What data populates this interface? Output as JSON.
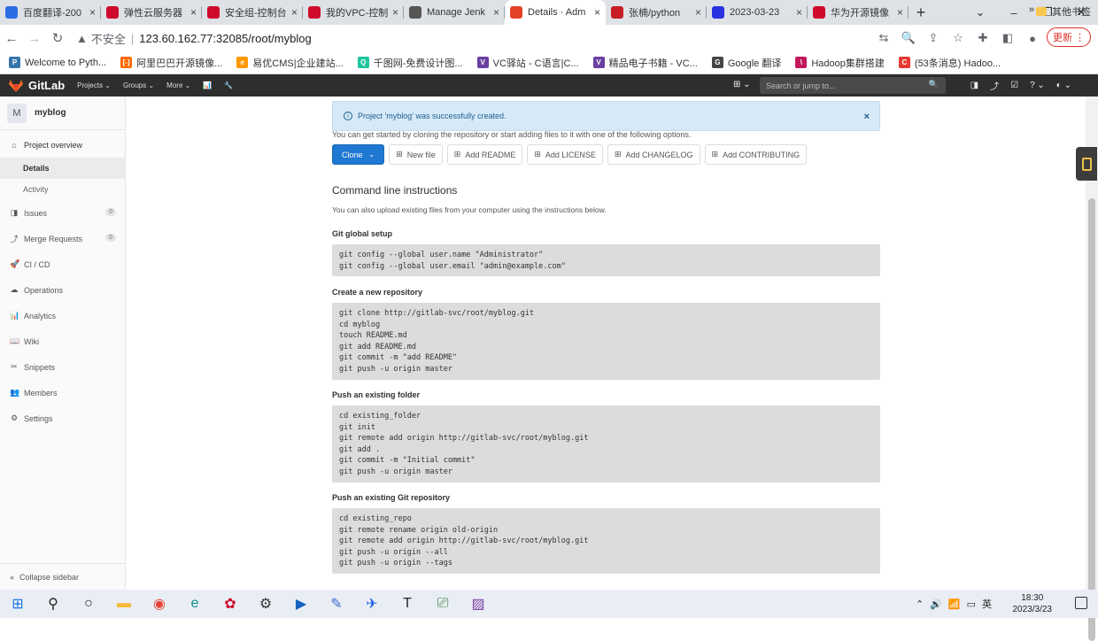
{
  "browser": {
    "tabs": [
      {
        "label": "百度翻译-200",
        "icon": "baidu-translate-icon",
        "color": "#2b6de5",
        "active": false
      },
      {
        "label": "弹性云服务器",
        "icon": "huawei-icon",
        "color": "#cf0a2c",
        "active": false
      },
      {
        "label": "安全组-控制台",
        "icon": "huawei-icon",
        "color": "#cf0a2c",
        "active": false
      },
      {
        "label": "我的VPC-控制",
        "icon": "huawei-icon",
        "color": "#cf0a2c",
        "active": false
      },
      {
        "label": "Manage Jenk",
        "icon": "jenkins-icon",
        "color": "#555555",
        "active": false
      },
      {
        "label": "Details · Adm",
        "icon": "gitlab-icon",
        "color": "#e24329",
        "active": true
      },
      {
        "label": "张楠/python",
        "icon": "gitee-icon",
        "color": "#c71d23",
        "active": false
      },
      {
        "label": "2023-03-23",
        "icon": "baidu-icon",
        "color": "#2932e1",
        "active": false
      },
      {
        "label": "华为开源镜像",
        "icon": "huawei-icon",
        "color": "#cf0a2c",
        "active": false
      }
    ],
    "tab_close": "×",
    "new_tab": "+",
    "window_controls": [
      "⌄",
      "–",
      "❐",
      "✕"
    ],
    "nav": {
      "back": "←",
      "forward": "→",
      "reload": "↻"
    },
    "address": {
      "warning": "▲",
      "insecure": "不安全",
      "sep": "|",
      "url": "123.60.162.77:32085/root/myblog"
    },
    "toolbar_icons": [
      "translate-icon",
      "zoom-icon",
      "share-icon",
      "star-icon",
      "extensions-icon",
      "sidepanel-icon",
      "profile-icon"
    ],
    "toolbar_glyphs": [
      "⇆",
      "🔍",
      "⇪",
      "☆",
      "✚",
      "◧",
      "●"
    ],
    "update_label": "更新 ⋮",
    "bookmarks": [
      {
        "label": "Welcome to Pyth...",
        "color": "#3776ab",
        "glyph": "P"
      },
      {
        "label": "阿里巴巴开源镜像...",
        "color": "#ff6a00",
        "glyph": "[-]"
      },
      {
        "label": "易优CMS|企业建站...",
        "color": "#ff9900",
        "glyph": "e"
      },
      {
        "label": "千图网-免费设计图...",
        "color": "#1ec59e",
        "glyph": "Q"
      },
      {
        "label": "VC驿站 - C语言|C...",
        "color": "#6b3fa0",
        "glyph": "V"
      },
      {
        "label": "精品电子书籍 - VC...",
        "color": "#6b3fa0",
        "glyph": "V"
      },
      {
        "label": "Google 翻译",
        "color": "#444444",
        "glyph": "G"
      },
      {
        "label": "Hadoop集群搭建",
        "color": "#c2185b",
        "glyph": "\\"
      },
      {
        "label": "(53条消息) Hadoo...",
        "color": "#e53935",
        "glyph": "C"
      }
    ],
    "bookmarks_more": "»",
    "other_bookmarks": "其他书签"
  },
  "gitlab_nav": {
    "brand": "GitLab",
    "menus": [
      "Projects ⌄",
      "Groups ⌄",
      "More ⌄",
      "📊",
      "🔧"
    ],
    "plus": "⊞ ⌄",
    "search_placeholder": "Search or jump to...",
    "search_icon": "🔍",
    "right_icons": [
      "◨",
      "⤴",
      "☑",
      "? ⌄",
      "◐ ⌄"
    ]
  },
  "sidebar": {
    "project_initial": "M",
    "project_name": "myblog",
    "overview": {
      "label": "Project overview",
      "icon": "⌂"
    },
    "sub": [
      {
        "label": "Details",
        "active": true
      },
      {
        "label": "Activity",
        "active": false
      }
    ],
    "items": [
      {
        "label": "Issues",
        "icon": "◨",
        "badge": "0"
      },
      {
        "label": "Merge Requests",
        "icon": "⤴",
        "badge": "0"
      },
      {
        "label": "CI / CD",
        "icon": "🚀",
        "badge": ""
      },
      {
        "label": "Operations",
        "icon": "☁",
        "badge": ""
      },
      {
        "label": "Analytics",
        "icon": "📊",
        "badge": ""
      },
      {
        "label": "Wiki",
        "icon": "📖",
        "badge": ""
      },
      {
        "label": "Snippets",
        "icon": "✂",
        "badge": ""
      },
      {
        "label": "Members",
        "icon": "👥",
        "badge": ""
      },
      {
        "label": "Settings",
        "icon": "⚙",
        "badge": ""
      }
    ],
    "collapse": {
      "label": "Collapse sidebar",
      "icon": "«"
    }
  },
  "main": {
    "alert": {
      "info": "i",
      "text": "Project 'myblog' was successfully created.",
      "close": "×"
    },
    "intro": "You can get started by cloning the repository or start adding files to it with one of the following options.",
    "buttons": {
      "clone": "Clone",
      "clone_chev": "⌄",
      "others": [
        "New file",
        "Add README",
        "Add LICENSE",
        "Add CHANGELOG",
        "Add CONTRIBUTING"
      ],
      "other_icon": "⊞"
    },
    "cli_title": "Command line instructions",
    "cli_desc": "You can also upload existing files from your computer using the instructions below.",
    "sections": [
      {
        "title": "Git global setup",
        "code": "git config --global user.name \"Administrator\"\ngit config --global user.email \"admin@example.com\""
      },
      {
        "title": "Create a new repository",
        "code": "git clone http://gitlab-svc/root/myblog.git\ncd myblog\ntouch README.md\ngit add README.md\ngit commit -m \"add README\"\ngit push -u origin master"
      },
      {
        "title": "Push an existing folder",
        "code": "cd existing_folder\ngit init\ngit remote add origin http://gitlab-svc/root/myblog.git\ngit add .\ngit commit -m \"Initial commit\"\ngit push -u origin master"
      },
      {
        "title": "Push an existing Git repository",
        "code": "cd existing_repo\ngit remote rename origin old-origin\ngit remote add origin http://gitlab-svc/root/myblog.git\ngit push -u origin --all\ngit push -u origin --tags"
      }
    ]
  },
  "taskbar": {
    "apps": [
      {
        "name": "start-icon",
        "glyph": "⊞",
        "color": "#1a73e8"
      },
      {
        "name": "search-icon",
        "glyph": "⚲",
        "color": "#222222"
      },
      {
        "name": "task-view-icon",
        "glyph": "○",
        "color": "#222222"
      },
      {
        "name": "file-explorer-icon",
        "glyph": "▬",
        "color": "#f6b93b"
      },
      {
        "name": "chrome-icon",
        "glyph": "◉",
        "color": "#ea4335"
      },
      {
        "name": "edge-icon",
        "glyph": "e",
        "color": "#0c8f8f"
      },
      {
        "name": "huawei-app-icon",
        "glyph": "✿",
        "color": "#cf0a2c"
      },
      {
        "name": "settings-icon",
        "glyph": "⚙",
        "color": "#333333"
      },
      {
        "name": "media-app-icon",
        "glyph": "▶",
        "color": "#1565c0"
      },
      {
        "name": "pen-app-icon",
        "glyph": "✎",
        "color": "#3d6bd1"
      },
      {
        "name": "feishu-icon",
        "glyph": "✈",
        "color": "#1e63e9"
      },
      {
        "name": "typora-icon",
        "glyph": "T",
        "color": "#222222"
      },
      {
        "name": "remote-desktop-icon",
        "glyph": "⎚",
        "color": "#2e7d32"
      },
      {
        "name": "image-app-icon",
        "glyph": "▨",
        "color": "#7b3fa0"
      }
    ],
    "tray": [
      "⌃",
      "🔊",
      "📶",
      "▭",
      "英"
    ],
    "time": "18:30",
    "date": "2023/3/23"
  }
}
